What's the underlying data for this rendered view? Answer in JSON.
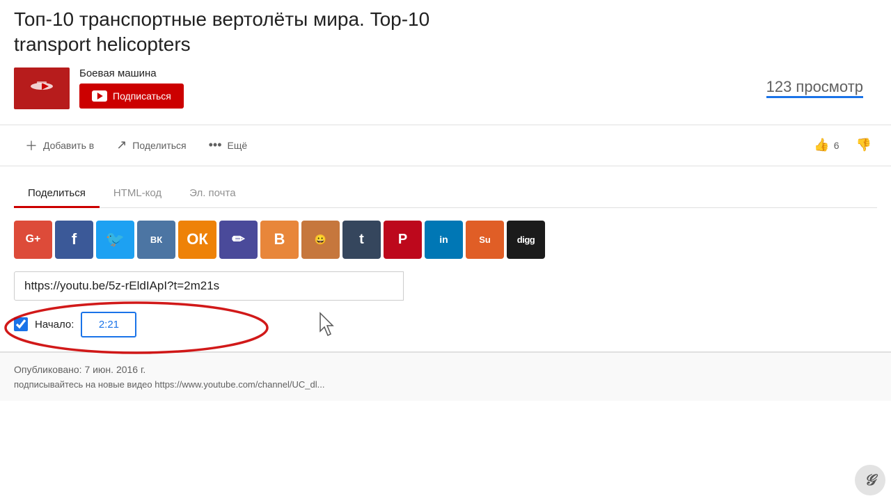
{
  "header": {
    "title_line1": "Топ-10 транспортные вертолёты мира. Top-10",
    "title_line2": "transport helicopters"
  },
  "channel": {
    "name": "Боевая машина",
    "avatar_text": "Боевая\nмашина",
    "subscribe_label": "Подписаться"
  },
  "stats": {
    "views": "123 просмотр"
  },
  "actions": {
    "add_to": "Добавить в",
    "share": "Поделиться",
    "more": "Ещё",
    "like_count": "6"
  },
  "share_panel": {
    "tab_share": "Поделиться",
    "tab_html": "HTML-код",
    "tab_email": "Эл. почта"
  },
  "social_icons": [
    {
      "name": "google-plus",
      "label": "G+",
      "color": "#dd4b39"
    },
    {
      "name": "facebook",
      "label": "f",
      "color": "#3b5998"
    },
    {
      "name": "twitter",
      "label": "🐦",
      "color": "#1da1f2"
    },
    {
      "name": "vk",
      "label": "ВК",
      "color": "#4c75a3"
    },
    {
      "name": "odnoklassniki",
      "label": "ОК",
      "color": "#ee8208"
    },
    {
      "name": "edit",
      "label": "✏",
      "color": "#4a4a9a"
    },
    {
      "name": "blogger",
      "label": "B",
      "color": "#e8863a"
    },
    {
      "name": "reddit",
      "label": "r/",
      "color": "#c6773d"
    },
    {
      "name": "tumblr",
      "label": "t",
      "color": "#35465d"
    },
    {
      "name": "pinterest",
      "label": "P",
      "color": "#bd081c"
    },
    {
      "name": "linkedin",
      "label": "in",
      "color": "#0077b5"
    },
    {
      "name": "stumbleupon",
      "label": "Su",
      "color": "#e05e26"
    },
    {
      "name": "digg",
      "label": "digg",
      "color": "#1b1b1b"
    }
  ],
  "url_field": {
    "value": "https://youtu.be/5z-rEldIApI?t=2m21s",
    "placeholder": "https://youtu.be/5z-rEldIApI?t=2m21s"
  },
  "start_time": {
    "label": "Начало:",
    "value": "2:21",
    "checked": true
  },
  "published": {
    "date_text": "Опубликовано: 7 июн. 2016 г.",
    "subscribe_text": "подписывайтесь на новые видео https://www.youtube.com/channel/UC_dl..."
  }
}
